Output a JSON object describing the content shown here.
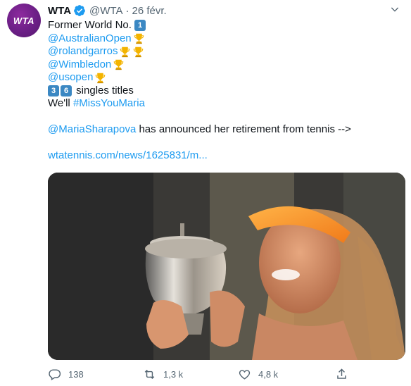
{
  "author": {
    "avatar_text": "WTA",
    "name": "WTA",
    "handle": "@WTA",
    "separator": "·",
    "date": "26 févr."
  },
  "tweet": {
    "line1_text": "Former World No.",
    "line1_keycap": "1",
    "mention_ao": "@AustralianOpen",
    "mention_rg": "@rolandgarros",
    "mention_wimbledon": "@Wimbledon",
    "mention_usopen": "@usopen",
    "titles_keycap_1": "3",
    "titles_keycap_2": "6",
    "titles_text": "singles titles",
    "closing_text": "We'll",
    "hashtag": "#MissYouMaria",
    "mention_maria": "@MariaSharapova",
    "announcement_text": " has announced her retirement from tennis -->",
    "link_text": "wtatennis.com/news/1625831/m..."
  },
  "actions": {
    "reply_count": "138",
    "retweet_count": "1,3 k",
    "like_count": "4,8 k"
  },
  "colors": {
    "link": "#1d9bf0",
    "secondary_text": "#536471",
    "verified": "#1d9bf0",
    "avatar": "#6b1f86"
  }
}
